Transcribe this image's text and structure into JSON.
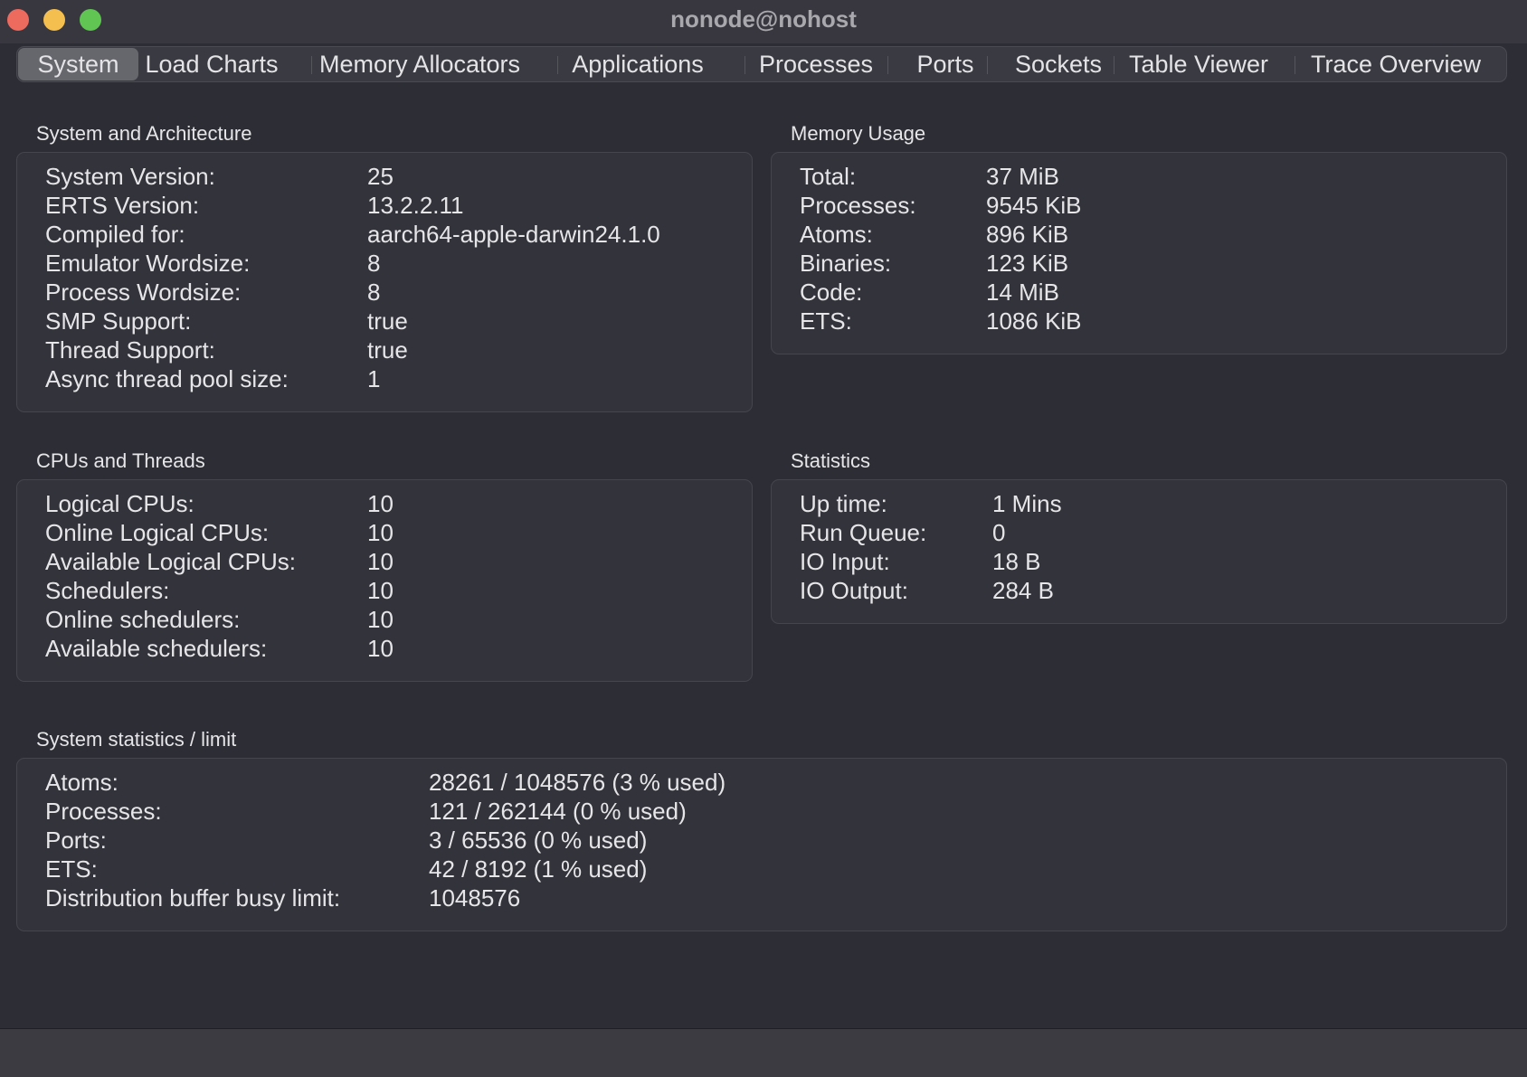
{
  "window": {
    "title": "nonode@nohost"
  },
  "tabs": [
    {
      "label": "System"
    },
    {
      "label": "Load Charts"
    },
    {
      "label": "Memory Allocators"
    },
    {
      "label": "Applications"
    },
    {
      "label": "Processes"
    },
    {
      "label": "Ports"
    },
    {
      "label": "Sockets"
    },
    {
      "label": "Table Viewer"
    },
    {
      "label": "Trace Overview"
    }
  ],
  "system_arch": {
    "title": "System and Architecture",
    "rows": [
      {
        "key": "System Version:",
        "value": "25"
      },
      {
        "key": "ERTS Version:",
        "value": "13.2.2.11"
      },
      {
        "key": "Compiled for:",
        "value": "aarch64-apple-darwin24.1.0"
      },
      {
        "key": "Emulator Wordsize:",
        "value": "8"
      },
      {
        "key": "Process Wordsize:",
        "value": "8"
      },
      {
        "key": "SMP Support:",
        "value": "true"
      },
      {
        "key": "Thread Support:",
        "value": "true"
      },
      {
        "key": "Async thread pool size:",
        "value": "1"
      }
    ]
  },
  "memory_usage": {
    "title": "Memory Usage",
    "rows": [
      {
        "key": "Total:",
        "value": "37 MiB"
      },
      {
        "key": "Processes:",
        "value": "9545 KiB"
      },
      {
        "key": "Atoms:",
        "value": "896 KiB"
      },
      {
        "key": "Binaries:",
        "value": "123 KiB"
      },
      {
        "key": "Code:",
        "value": "14 MiB"
      },
      {
        "key": "ETS:",
        "value": "1086 KiB"
      }
    ]
  },
  "cpus_threads": {
    "title": "CPUs and Threads",
    "rows": [
      {
        "key": "Logical CPUs:",
        "value": "10"
      },
      {
        "key": "Online Logical CPUs:",
        "value": "10"
      },
      {
        "key": "Available Logical CPUs:",
        "value": "10"
      },
      {
        "key": "Schedulers:",
        "value": "10"
      },
      {
        "key": "Online schedulers:",
        "value": "10"
      },
      {
        "key": "Available schedulers:",
        "value": "10"
      }
    ]
  },
  "statistics": {
    "title": "Statistics",
    "rows": [
      {
        "key": "Up time:",
        "value": "1 Mins"
      },
      {
        "key": "Run Queue:",
        "value": "0"
      },
      {
        "key": "IO Input:",
        "value": "18 B"
      },
      {
        "key": "IO Output:",
        "value": "284 B"
      }
    ]
  },
  "system_limits": {
    "title": "System statistics / limit",
    "rows": [
      {
        "key": "Atoms:",
        "value": "28261 / 1048576 (3 % used)"
      },
      {
        "key": "Processes:",
        "value": "121 / 262144 (0 % used)"
      },
      {
        "key": "Ports:",
        "value": "3 / 65536 (0 % used)"
      },
      {
        "key": "ETS:",
        "value": "42 / 8192 (1 % used)"
      },
      {
        "key": "Distribution buffer busy limit:",
        "value": "1048576"
      }
    ]
  }
}
